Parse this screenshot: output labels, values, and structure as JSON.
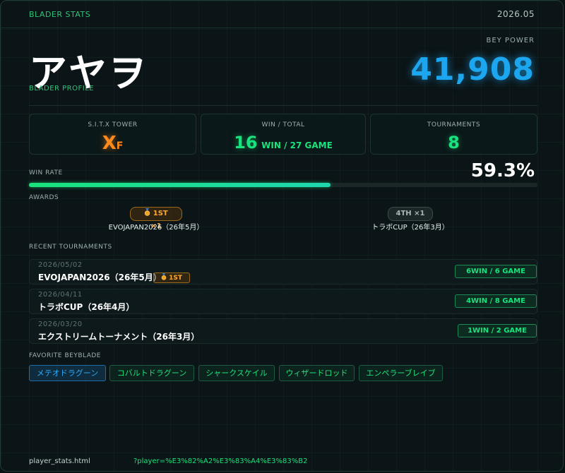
{
  "header": {
    "brand": "BLADER STATS",
    "date": "2026.05"
  },
  "profile": {
    "name": "アヤヲ",
    "subtitle": "BLADER PROFILE",
    "power_label": "BEY POWER",
    "power_value": "41,908"
  },
  "stats": {
    "tower": {
      "label": "S.I.T.X TOWER",
      "main": "X",
      "sub": "F"
    },
    "win_total": {
      "label": "WIN / TOTAL",
      "wins": "16",
      "detail": "WIN / 27 GAME"
    },
    "tournaments": {
      "label": "TOURNAMENTS",
      "value": "8"
    }
  },
  "win_rate": {
    "label": "WIN RATE",
    "value_text": "59.3%",
    "fraction": 0.593
  },
  "awards": {
    "label": "AWARDS",
    "items": [
      {
        "medal_icon": "medal-icon",
        "badge": "1ST ×1",
        "event": "EVOJAPAN2026（26年5月）"
      },
      {
        "badge": "4TH ×1",
        "event": "トラボCUP（26年3月）"
      }
    ]
  },
  "recent": {
    "label": "RECENT TOURNAMENTS",
    "items": [
      {
        "date": "2026/05/02",
        "name": "EVOJAPAN2026（26年5月）",
        "rank": "1ST",
        "result": "6WIN / 6 GAME"
      },
      {
        "date": "2026/04/11",
        "name": "トラボCUP（26年4月）",
        "rank": "",
        "result": "4WIN / 8 GAME"
      },
      {
        "date": "2026/03/20",
        "name": "エクストリームトーナメント（26年3月）",
        "rank": "",
        "result": "1WIN / 2 GAME"
      }
    ]
  },
  "favorites": {
    "label": "FAVORITE BEYBLADE",
    "items": [
      "メテオドラグーン",
      "コバルトドラグーン",
      "シャークスケイル",
      "ウィザードロッド",
      "エンペラーブレイブ"
    ]
  },
  "footer": {
    "file": "player_stats.html",
    "query": "?player=%E3%82%A2%E3%83%A4%E3%83%B2"
  },
  "colors": {
    "accent_green": "#19e37c",
    "accent_blue": "#1da6f0",
    "accent_orange": "#ff8a1c"
  }
}
